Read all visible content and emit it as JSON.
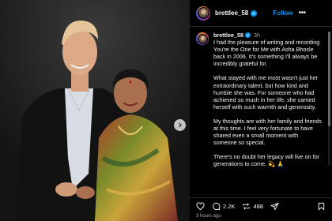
{
  "post": {
    "username": "brettlee_58",
    "follow_label": "Follow",
    "more_label": "•••",
    "caption_time": "3h",
    "caption_paragraphs": [
      "I had the pleasure of writing and recording You're the One for Me with Asha Bhosle back in 2006. It's something I'll always be incredibly grateful for.",
      "What stayed with me most wasn't just her extraordinary talent, but how kind and humble she was. For someone who had achieved so much in her life, she carried herself with such warmth and generosity.",
      "My thoughts are with her family and friends at this time. I feel very fortunate to have shared even a small moment with someone so special.",
      "There's no doubt her legacy will live on for generations to come. 💫 🙏"
    ],
    "comments_count": "2.2K",
    "shares_count": "488",
    "timestamp": "3 hours ago"
  },
  "icons": {
    "verified": "verified-badge-icon",
    "like": "heart-icon",
    "comment": "comment-icon",
    "share": "repost-icon",
    "send": "send-icon",
    "save": "bookmark-icon",
    "next": "chevron-right-icon"
  },
  "colors": {
    "accent": "#0095f6",
    "background": "#000000",
    "muted_text": "#a8a8a8"
  }
}
